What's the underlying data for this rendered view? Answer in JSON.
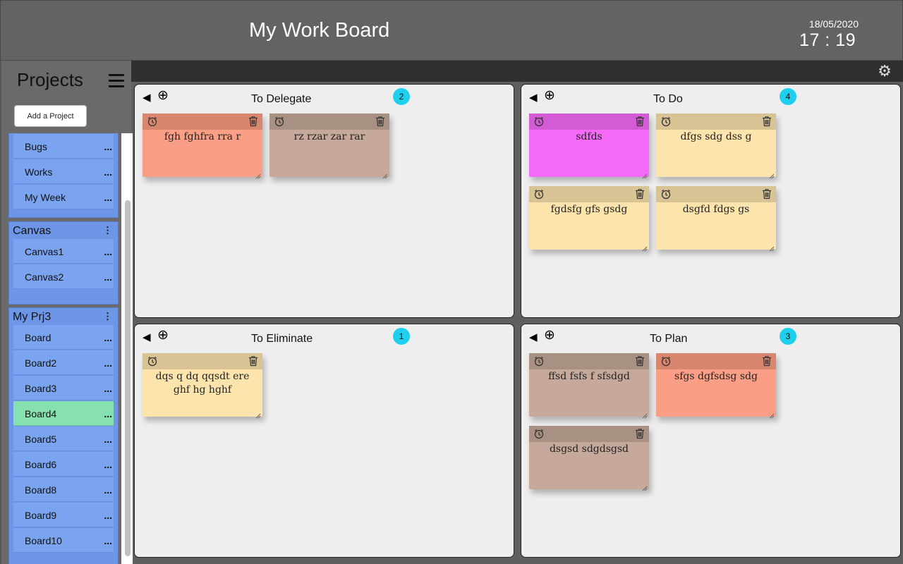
{
  "header": {
    "title": "My Work Board",
    "date": "18/05/2020",
    "time": "17 : 19"
  },
  "sidebar": {
    "title": "Projects",
    "add_button": "Add a Project",
    "groups": [
      {
        "name": "",
        "items": [
          "Bugs",
          "Works",
          "My Week"
        ]
      },
      {
        "name": "Canvas",
        "items": [
          "Canvas1",
          "Canvas2"
        ]
      },
      {
        "name": "My Prj3",
        "items": [
          "Board",
          "Board2",
          "Board3",
          "Board4",
          "Board5",
          "Board6",
          "Board8",
          "Board9",
          "Board10"
        ],
        "active": "Board4"
      }
    ],
    "item_menu": "...",
    "group_menu": "⋮"
  },
  "quadrants": [
    {
      "title": "To Delegate",
      "count": "2",
      "notes": [
        {
          "text": "fgh  fghfra rra r",
          "color": "#fa9e85",
          "bar": "#d9866f"
        },
        {
          "text": "rz  rzar  zar rar",
          "color": "#c6a99a",
          "bar": "#a89083"
        }
      ]
    },
    {
      "title": "To Do",
      "count": "4",
      "notes": [
        {
          "text": "sdfds",
          "color": "#f56af9",
          "bar": "#d35bd6"
        },
        {
          "text": "dfgs sdg dss g",
          "color": "#fde3ac",
          "bar": "#d8c394"
        },
        {
          "text": "fgdsfg gfs gsdg",
          "color": "#fde3ac",
          "bar": "#d8c394"
        },
        {
          "text": "dsgfd fdgs gs",
          "color": "#fde3ac",
          "bar": "#d8c394"
        }
      ]
    },
    {
      "title": "To Eliminate",
      "count": "1",
      "notes": [
        {
          "text": "dqs q dq qqsdt ere ghf hg hghf",
          "color": "#fde3ac",
          "bar": "#d8c394"
        }
      ]
    },
    {
      "title": "To Plan",
      "count": "3",
      "notes": [
        {
          "text": "ffsd  fsfs f sfsdgd",
          "color": "#c6a99a",
          "bar": "#a89083"
        },
        {
          "text": "sfgs dgfsdsg sdg",
          "color": "#fa9e85",
          "bar": "#d9866f"
        },
        {
          "text": "dsgsd sdgdsgsd",
          "color": "#c6a99a",
          "bar": "#a89083"
        }
      ]
    }
  ],
  "icons": {
    "back": "◀",
    "add": "⊕",
    "settings": "⚙"
  }
}
